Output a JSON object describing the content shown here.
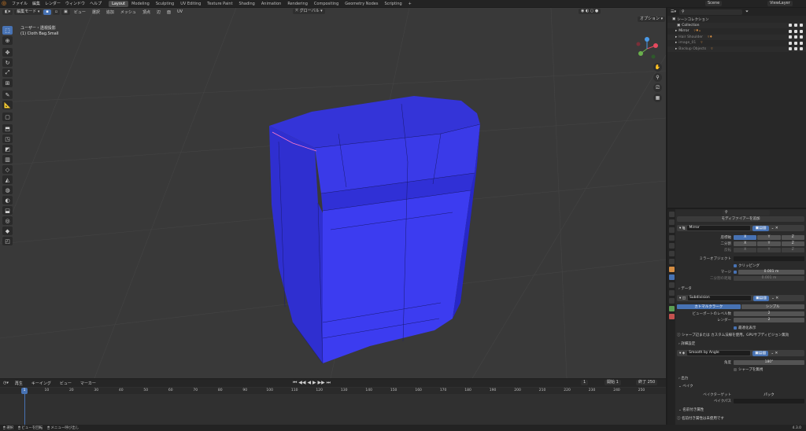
{
  "topbar": {
    "menus": [
      "ファイル",
      "編集",
      "レンダー",
      "ウィンドウ",
      "ヘルプ"
    ],
    "workspaces": [
      "Layout",
      "Modeling",
      "Sculpting",
      "UV Editing",
      "Texture Paint",
      "Shading",
      "Animation",
      "Rendering",
      "Compositing",
      "Geometry Nodes",
      "Scripting"
    ],
    "active_workspace": "Layout",
    "scene_label": "Scene",
    "viewlayer_label": "ViewLayer"
  },
  "viewport": {
    "mode": "編集モード",
    "menus": [
      "ビュー",
      "選択",
      "追加",
      "メッシュ",
      "頂点",
      "辺",
      "面",
      "UV"
    ],
    "orientation": "グローバル",
    "options": "オプション",
    "info_line1": "ユーザー・透視投影",
    "info_line2": "(1) Cloth Bag.Small"
  },
  "outliner": {
    "search_placeholder": "",
    "title": "シーンコレクション",
    "rows": [
      {
        "label": "Collection",
        "dim": false
      },
      {
        "label": "Mirror",
        "dim": false
      },
      {
        "label": "Hair Shoulder",
        "dim": true
      },
      {
        "label": "image_01",
        "dim": true
      },
      {
        "label": "Backup Objects",
        "dim": true
      }
    ]
  },
  "properties": {
    "search_placeholder": "",
    "add_modifier": "モディファイアーを追加",
    "mirror": {
      "name": "Mirror",
      "axis_label": "座標軸",
      "bisect_label": "二分割",
      "flip_label": "反転",
      "x": "X",
      "y": "Y",
      "z": "Z",
      "mirror_object_label": "ミラーオブジェクト",
      "clipping": "クリッピング",
      "merge_label": "マージ",
      "merge_value": "0.001 m",
      "bisect_distance_label": "二分割の距離",
      "bisect_distance_value": "0.001 m",
      "data_section": "データ"
    },
    "subdivision": {
      "name": "Subdivision",
      "catmull": "カトマルクラーク",
      "simple": "シンプル",
      "viewport_levels_label": "ビューポートのレベル数",
      "viewport_levels": "2",
      "render_label": "レンダー",
      "render_levels": "2",
      "optimal_display": "最適化表示",
      "info": "シャープ辺または カスタム法線を使用。GPUサブディビジョン無効",
      "advanced": "詳細設定"
    },
    "smooth": {
      "name": "Smooth by Angle",
      "angle_label": "角度",
      "angle_value": "180°",
      "ignore_sharp": "シャープを無視",
      "output": "出力",
      "bake": "ベイク",
      "bake_target": "ベイクターゲット",
      "bake_mode": "パック",
      "bake_path": "ベイクパス",
      "attr_section": "名前付き属性",
      "attr_info": "名前付き属性は未使用です"
    }
  },
  "timeline": {
    "menus": [
      "再生",
      "キーイング",
      "ビュー",
      "マーカー"
    ],
    "current_frame": "1",
    "start_label": "開始",
    "start": "1",
    "end_label": "終了",
    "end": "250",
    "ticks": [
      "1",
      "10",
      "20",
      "30",
      "40",
      "50",
      "60",
      "70",
      "80",
      "90",
      "100",
      "110",
      "120",
      "130",
      "140",
      "150",
      "160",
      "170",
      "180",
      "190",
      "200",
      "210",
      "220",
      "230",
      "240",
      "250"
    ]
  },
  "statusbar": {
    "items": [
      "選択",
      "ビューを回転",
      "メニュー呼び出し"
    ],
    "version": "4.3.0"
  },
  "colors": {
    "accent": "#4772b3",
    "mesh_fill": "#3a3ae8",
    "viewport_bg": "#393939"
  }
}
